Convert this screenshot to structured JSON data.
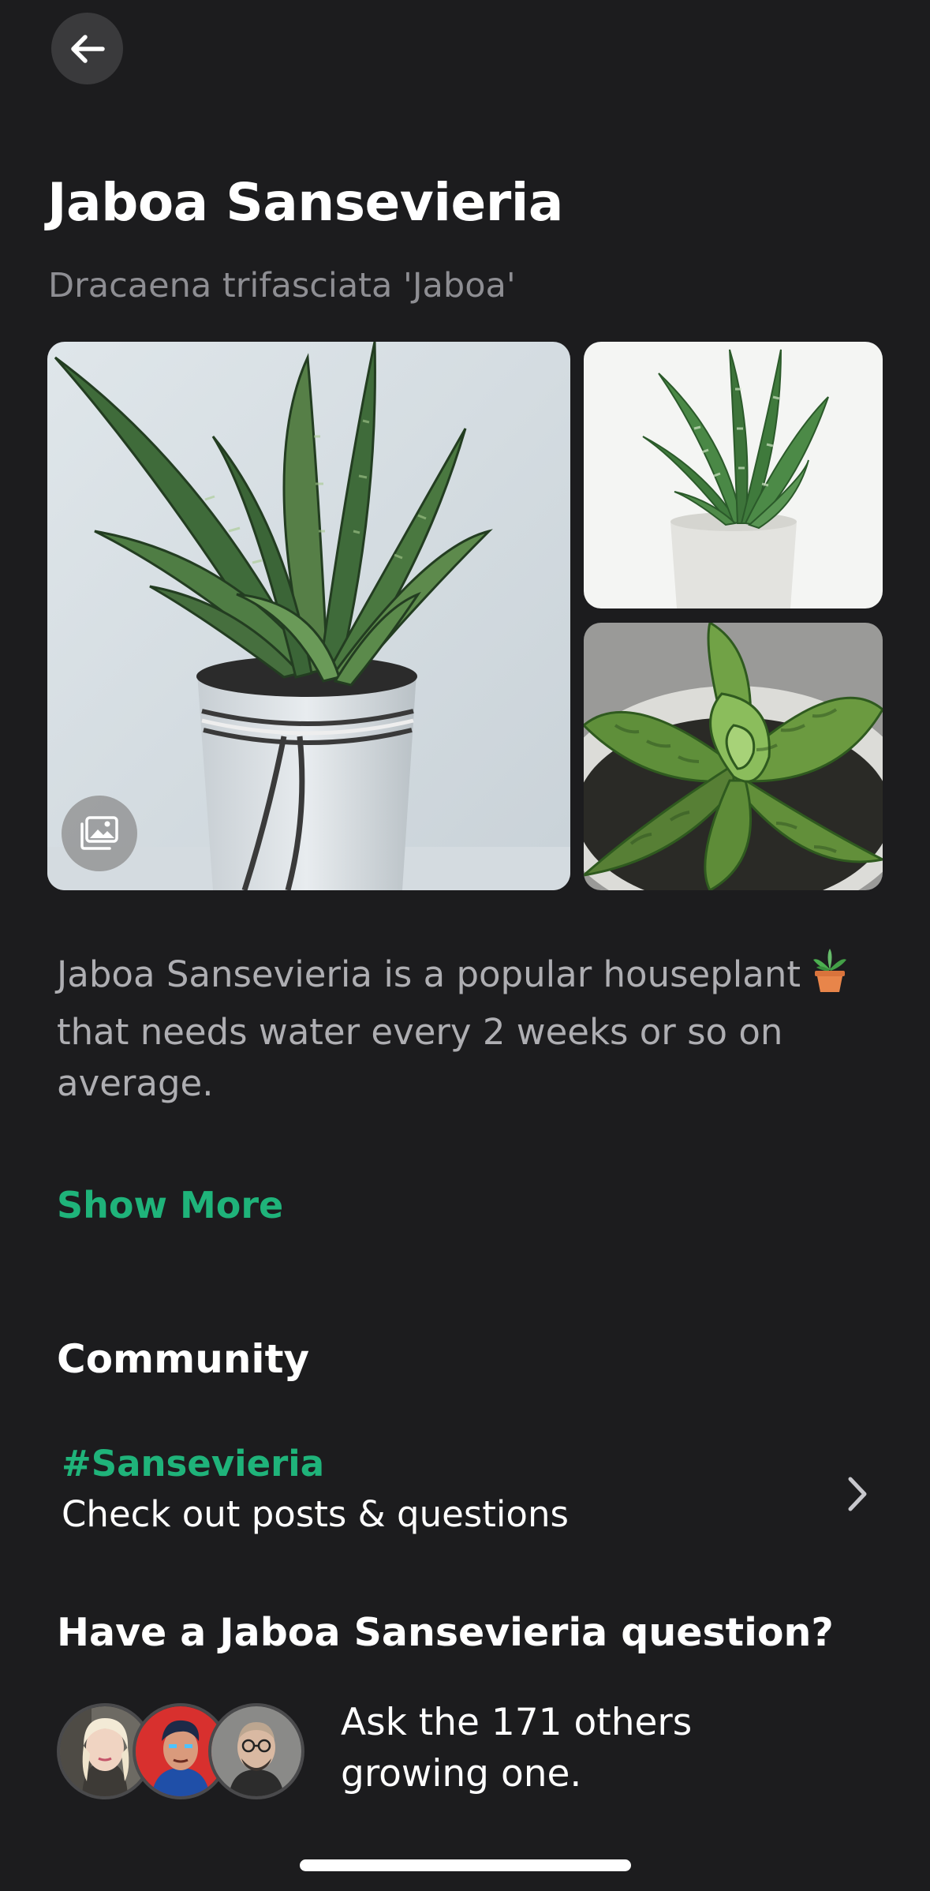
{
  "header": {
    "back_icon": "arrow-left-icon"
  },
  "plant": {
    "name": "Jaboa Sansevieria",
    "scientific_name": "Dracaena trifasciata 'Jaboa'",
    "description": "Jaboa Sansevieria is a popular houseplant",
    "description_emoji": "potted-plant-icon",
    "description_cont": "that needs water every 2 weeks or so on average."
  },
  "gallery": {
    "button_icon": "gallery-icon"
  },
  "actions": {
    "show_more_label": "Show More"
  },
  "community": {
    "heading": "Community",
    "tag": "#Sansevieria",
    "subtitle": "Check out posts & questions",
    "chevron_icon": "chevron-right-icon"
  },
  "question": {
    "heading": "Have a Jaboa Sansevieria question?",
    "ask_text": "Ask the 171 others growing one."
  },
  "colors": {
    "background": "#1c1c1e",
    "accent": "#1fb37a",
    "secondary_text": "#8e8e93",
    "body_text": "#aeaeb2"
  }
}
